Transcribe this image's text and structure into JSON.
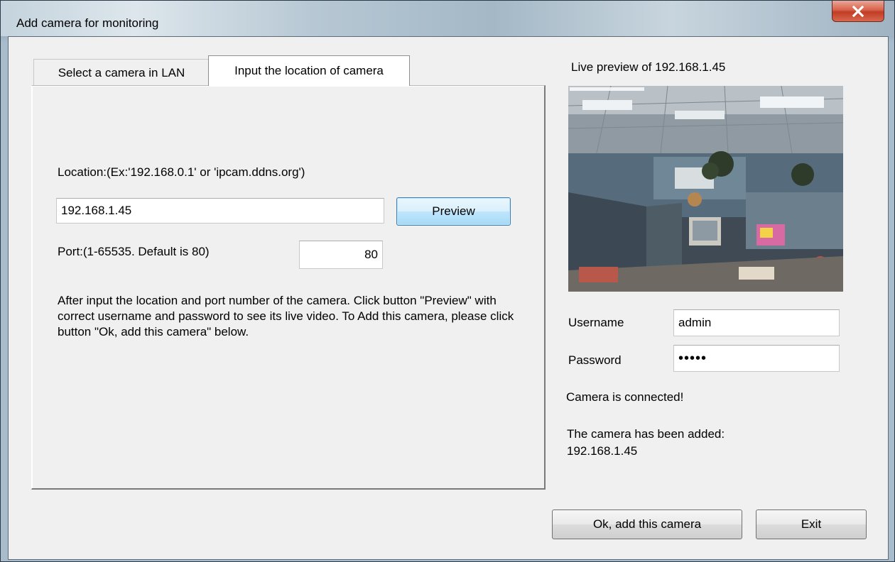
{
  "window": {
    "title": "Add camera for monitoring",
    "close_label": "X"
  },
  "tabs": [
    {
      "label": "Select a camera in LAN",
      "active": false
    },
    {
      "label": "Input the location of camera",
      "active": true
    }
  ],
  "location": {
    "label": "Location:(Ex:'192.168.0.1' or 'ipcam.ddns.org')",
    "value": "192.168.1.45",
    "preview_button": "Preview"
  },
  "port": {
    "label": "Port:(1-65535. Default is 80)",
    "value": "80"
  },
  "instructions": "After input the location and port number of the camera. Click button \"Preview\" with correct username and password to see its live video. To Add this camera, please click button \"Ok, add this camera\" below.",
  "preview_panel": {
    "title": "Live preview of 192.168.1.45",
    "image_semantic": "office-cubicle-camera-feed"
  },
  "credentials": {
    "username_label": "Username",
    "username_value": "admin",
    "password_label": "Password",
    "password_value": "•••••"
  },
  "status": {
    "connected": "Camera is connected!",
    "added_line1": "The camera has been added:",
    "added_line2": "192.168.1.45"
  },
  "buttons": {
    "ok": "Ok, add this camera",
    "exit": "Exit"
  },
  "colors": {
    "close_button": "#c8432a",
    "focused_button_border": "#3c7fb1"
  }
}
